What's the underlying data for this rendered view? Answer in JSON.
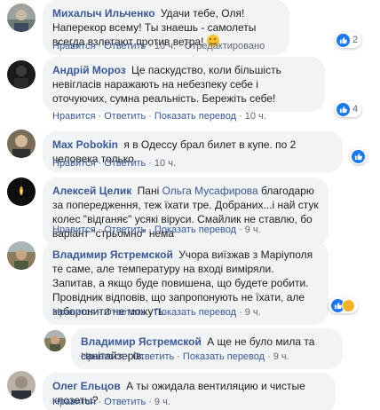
{
  "comments": [
    {
      "author": "Михалыч Ильченко",
      "text": "Удачи тебе, Оля! Наперекор всему! Ты знаешь - самолеты всегда взлетают против ветра!",
      "has_emoji": true,
      "like": "Нравится",
      "reply": "Ответить",
      "time": "10 ч.",
      "extra": "Отредактировано",
      "reactions": "2"
    },
    {
      "author": "Андрій Мороз",
      "text": "Це паскудство, коли більшість невігласів наражають на небезпеку себе і оточуючих, сумна реальність. Бережіть себе!",
      "like": "Нравится",
      "reply": "Ответить",
      "translate": "Показать перевод",
      "time": "10 ч.",
      "reactions": "4"
    },
    {
      "author": "Max Pobokin",
      "text": "я в Одессу брал билет в купе. по 2 человека только.",
      "like": "Нравится",
      "reply": "Ответить",
      "time": "10 ч."
    },
    {
      "author": "Алексей Целик",
      "text_before": "Пані",
      "mention": "Ольга Мусафирова",
      "text_after": "благодарю за попередження, теж їхати тре. Добраних...і най стук колес \"відганяє\" усякі віруси. Смайлик не ставлю, бо варіант \"стрьомно\" нема",
      "like": "Нравится",
      "reply": "Ответить",
      "translate": "Показать перевод",
      "time": "9 ч."
    },
    {
      "author": "Владимир Ястремской",
      "text": "Учора виїзжав з Маріуполя те саме, але температуру на вході виміряли. Запитав, а якщо буде повишена, що будете робити. Провідник відповів, що запропонують не їхати, але заборонити не можуть.",
      "like": "Нравится",
      "reply": "Ответить",
      "translate": "Показать перевод",
      "time": "9 ч."
    },
    {
      "author": "Владимир Ястремской",
      "text": "А ще не було мила та санітайзерів.",
      "like": "Нравится",
      "reply": "Ответить",
      "translate": "Показать перевод",
      "time": "9 ч."
    },
    {
      "author": "Олег Ельцов",
      "text": "А ты ожидала вентиляцию и чистые клозеты?",
      "like": "Нравится",
      "reply": "Ответить",
      "time": "9 ч."
    }
  ],
  "colors": {
    "link": "#385898",
    "bubble": "#f2f3f5",
    "like": "#1877f2",
    "haha": "#f7b125"
  },
  "icons": [
    "like-icon",
    "haha-icon",
    "smile-emoji-icon"
  ]
}
